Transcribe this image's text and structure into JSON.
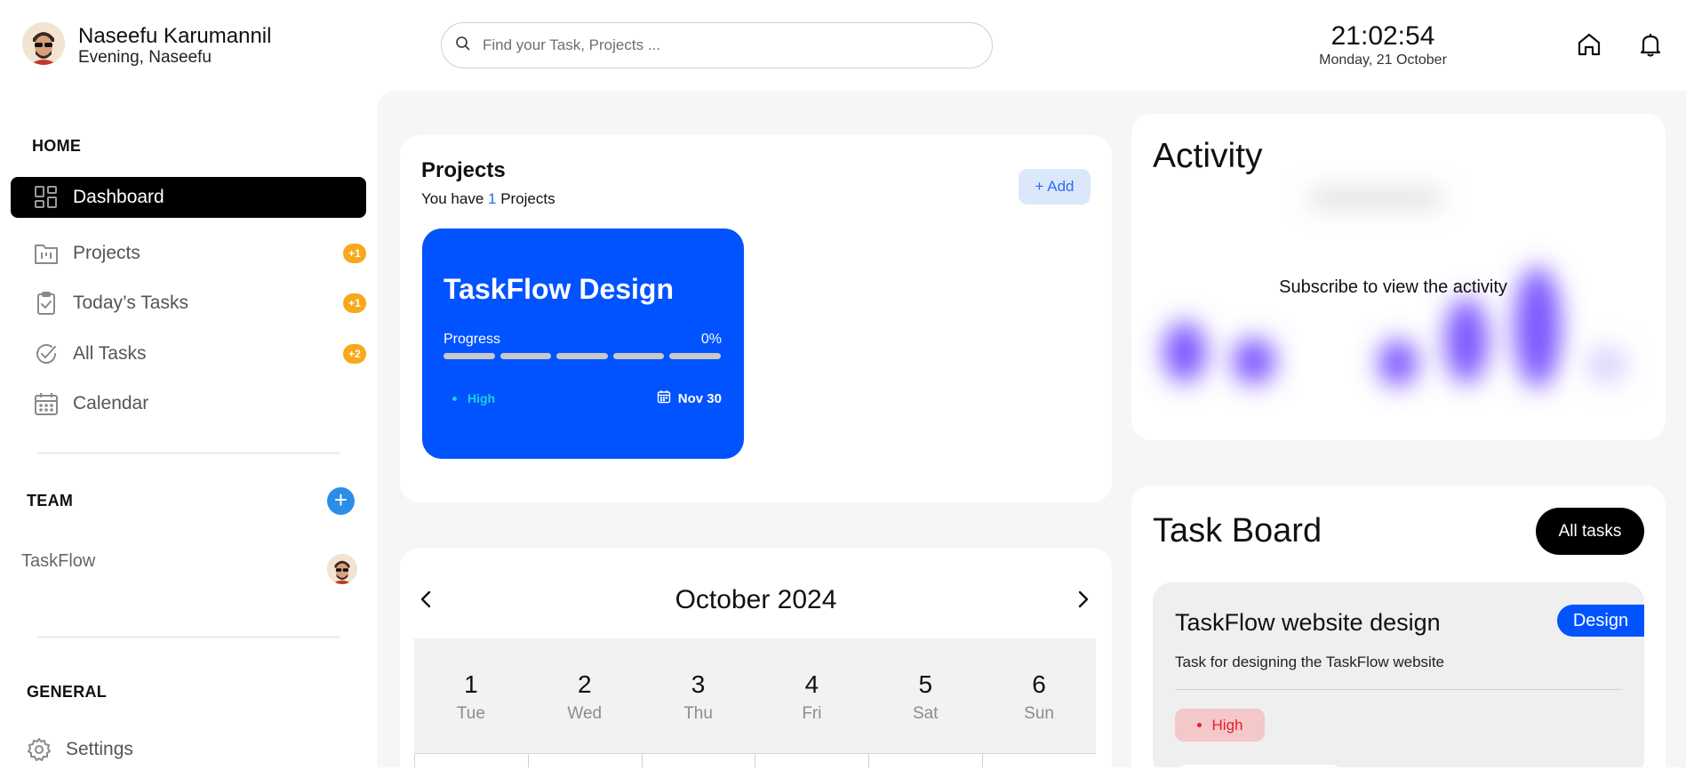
{
  "header": {
    "user_name": "Naseefu Karumannil",
    "greeting": "Evening, Naseefu",
    "search_placeholder": "Find your Task, Projects ...",
    "time": "21:02:54",
    "date": "Monday, 21 October",
    "icons": [
      "search-icon",
      "home-icon",
      "bell-icon"
    ]
  },
  "sidebar": {
    "home_title": "HOME",
    "items": [
      {
        "label": "Dashboard",
        "icon": "dashboard-grid-icon",
        "active": true
      },
      {
        "label": "Projects",
        "icon": "folder-icon",
        "badge": "+1"
      },
      {
        "label": "Today’s Tasks",
        "icon": "clipboard-check-icon",
        "badge": "+1"
      },
      {
        "label": "All Tasks",
        "icon": "check-circle-icon",
        "badge": "+2"
      },
      {
        "label": "Calendar",
        "icon": "calendar-icon"
      }
    ],
    "team_title": "TEAM",
    "team_add": "+",
    "team_name": "TaskFlow",
    "general_title": "GENERAL",
    "settings_label": "Settings"
  },
  "projects": {
    "title": "Projects",
    "subtitle_prefix": "You have ",
    "count": "1",
    "subtitle_suffix": " Projects",
    "add_label": "+ Add",
    "tile": {
      "name": "TaskFlow Design",
      "progress_label": "Progress",
      "progress_value": "0%",
      "progress_fraction": 0,
      "priority": "High",
      "due": "Nov 30"
    }
  },
  "calendar": {
    "title": "October 2024",
    "days": [
      {
        "num": "1",
        "dow": "Tue"
      },
      {
        "num": "2",
        "dow": "Wed"
      },
      {
        "num": "3",
        "dow": "Thu"
      },
      {
        "num": "4",
        "dow": "Fri"
      },
      {
        "num": "5",
        "dow": "Sat"
      },
      {
        "num": "6",
        "dow": "Sun"
      }
    ]
  },
  "activity": {
    "title": "Activity",
    "message": "Subscribe to view the activity"
  },
  "task_board": {
    "title": "Task Board",
    "all_tasks_label": "All tasks",
    "task": {
      "title": "TaskFlow website design",
      "tag": "Design",
      "description": "Task for designing the TaskFlow website",
      "priority": "High"
    }
  },
  "colors": {
    "accent_blue": "#0053ff",
    "badge_orange": "#f7a81b",
    "priority_red": "#e81d2b",
    "activity_purple": "#7b55ff"
  }
}
